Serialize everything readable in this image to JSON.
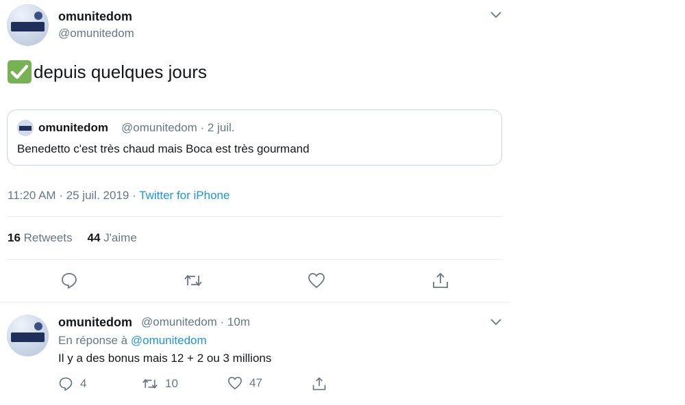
{
  "main_tweet": {
    "author_name": "omunitedom",
    "author_handle": "@omunitedom",
    "text_icon": "check-mark-icon",
    "text": "depuis quelques jours",
    "quoted": {
      "author_name": "omunitedom",
      "meta": "@omunitedom · 2 juil.",
      "text": "Benedetto c'est très chaud mais Boca est très gourmand"
    },
    "timestamp": "11:20 AM · 25 juil. 2019 · ",
    "source": "Twitter for iPhone",
    "retweets_count": "16",
    "retweets_label": "Retweets",
    "likes_count": "44",
    "likes_label": "J'aime",
    "actions": [
      "reply-icon",
      "retweet-icon",
      "like-icon",
      "share-icon"
    ]
  },
  "reply_tweet": {
    "author_name": "omunitedom",
    "author_meta": "@omunitedom · 10m",
    "in_reply_prefix": "En réponse à ",
    "in_reply_handle": "@omunitedom",
    "text": "Il y a des bonus mais 12 + 2 ou 3 millions",
    "reply_count": "4",
    "retweet_count": "10",
    "like_count": "47"
  },
  "colors": {
    "text": "#14171a",
    "secondary": "#657786",
    "link": "#1b95e0",
    "border": "#ccd6dd",
    "divider": "#e6ecf0",
    "check": "#77b255"
  }
}
